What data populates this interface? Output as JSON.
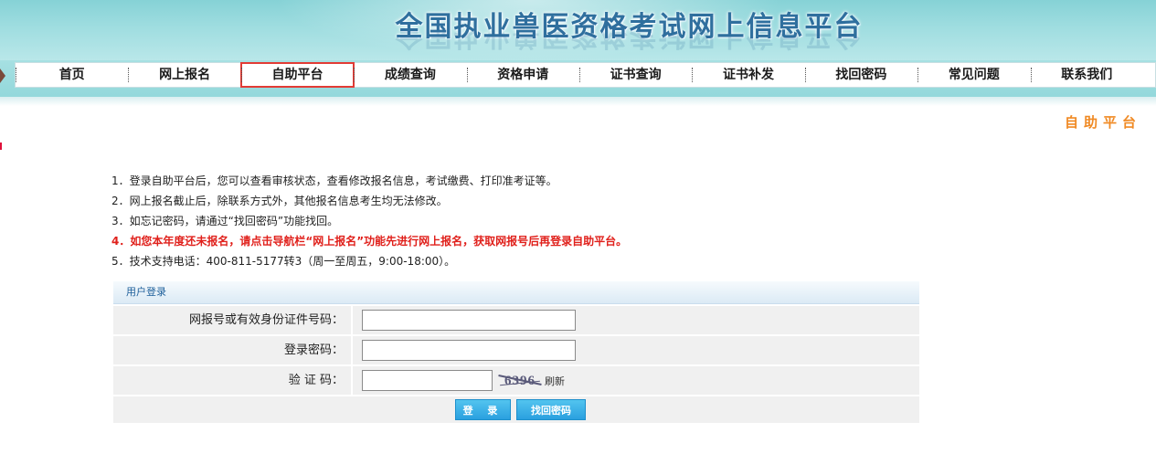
{
  "header": {
    "site_title": "全国执业兽医资格考试网上信息平台"
  },
  "nav": {
    "items": [
      "首页",
      "网上报名",
      "自助平台",
      "成绩查询",
      "资格申请",
      "证书查询",
      "证书补发",
      "找回密码",
      "常见问题",
      "联系我们"
    ],
    "active": "自助平台"
  },
  "page": {
    "title": "自助平台"
  },
  "notes": [
    "1．登录自助平台后，您可以查看审核状态，查看修改报名信息，考试缴费、打印准考证等。",
    "2．网上报名截止后，除联系方式外，其他报名信息考生均无法修改。",
    "3．如忘记密码，请通过“找回密码”功能找回。",
    "4．如您本年度还未报名，请点击导航栏“网上报名”功能先进行网上报名，获取网报号后再登录自助平台。",
    "5．技术支持电话：400-811-5177转3（周一至周五，9:00-18:00）。"
  ],
  "login": {
    "panel_title": "用户登录",
    "id_label": "网报号或有效身份证件号码：",
    "id_value": "",
    "password_label": "登录密码：",
    "password_value": "",
    "captcha_label": "验 证 码：",
    "captcha_value": "",
    "captcha_text": "6396",
    "refresh_label": "刷新",
    "login_button": "登 录",
    "forgot_button": "找回密码"
  },
  "colors": {
    "banner": "#9fdde0",
    "nav_active_outline": "#e23b35",
    "page_title": "#f08a24",
    "warning_text": "#e0201b",
    "button": "#2aa0df"
  }
}
